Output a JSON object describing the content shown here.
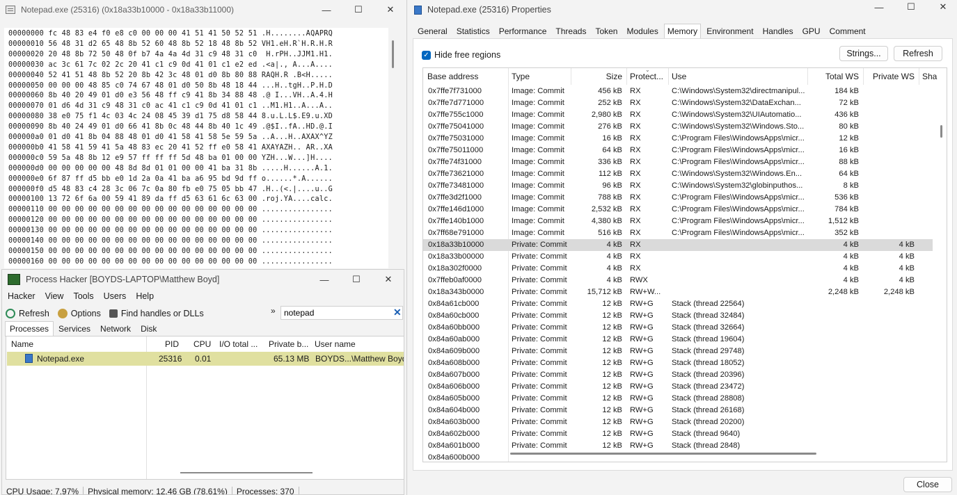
{
  "hex_window": {
    "title": "Notepad.exe (25316) (0x18a33b10000 - 0x18a33b11000)",
    "lines": [
      "00000000 fc 48 83 e4 f0 e8 c0 00 00 00 41 51 41 50 52 51 .H........AQAPRQ",
      "00000010 56 48 31 d2 65 48 8b 52 60 48 8b 52 18 48 8b 52 VH1.eH.R`H.R.H.R",
      "00000020 20 48 8b 72 50 48 0f b7 4a 4a 4d 31 c9 48 31 c0  H.rPH..JJM1.H1.",
      "00000030 ac 3c 61 7c 02 2c 20 41 c1 c9 0d 41 01 c1 e2 ed .<a|., A...A....",
      "00000040 52 41 51 48 8b 52 20 8b 42 3c 48 01 d0 8b 80 88 RAQH.R .B<H.....",
      "00000050 00 00 00 48 85 c0 74 67 48 01 d0 50 8b 48 18 44 ...H..tgH..P.H.D",
      "00000060 8b 40 20 49 01 d0 e3 56 48 ff c9 41 8b 34 88 48 .@ I...VH..A.4.H",
      "00000070 01 d6 4d 31 c9 48 31 c0 ac 41 c1 c9 0d 41 01 c1 ..M1.H1..A...A..",
      "00000080 38 e0 75 f1 4c 03 4c 24 08 45 39 d1 75 d8 58 44 8.u.L.L$.E9.u.XD",
      "00000090 8b 40 24 49 01 d0 66 41 8b 0c 48 44 8b 40 1c 49 .@$I..fA..HD.@.I",
      "000000a0 01 d0 41 8b 04 88 48 01 d0 41 58 41 58 5e 59 5a ..A...H..AXAX^YZ",
      "000000b0 41 58 41 59 41 5a 48 83 ec 20 41 52 ff e0 58 41 AXAYAZH.. AR..XA",
      "000000c0 59 5a 48 8b 12 e9 57 ff ff ff 5d 48 ba 01 00 00 YZH...W...]H....",
      "000000d0 00 00 00 00 00 48 8d 8d 01 01 00 00 41 ba 31 8b .....H......A.1.",
      "000000e0 6f 87 ff d5 bb e0 1d 2a 0a 41 ba a6 95 bd 9d ff o......*.A......",
      "000000f0 d5 48 83 c4 28 3c 06 7c 0a 80 fb e0 75 05 bb 47 .H..(<.|....u..G",
      "00000100 13 72 6f 6a 00 59 41 89 da ff d5 63 61 6c 63 00 .roj.YA....calc.",
      "00000110 00 00 00 00 00 00 00 00 00 00 00 00 00 00 00 00 ................",
      "00000120 00 00 00 00 00 00 00 00 00 00 00 00 00 00 00 00 ................",
      "00000130 00 00 00 00 00 00 00 00 00 00 00 00 00 00 00 00 ................",
      "00000140 00 00 00 00 00 00 00 00 00 00 00 00 00 00 00 00 ................",
      "00000150 00 00 00 00 00 00 00 00 00 00 00 00 00 00 00 00 ................",
      "00000160 00 00 00 00 00 00 00 00 00 00 00 00 00 00 00 00 ................"
    ]
  },
  "ph": {
    "title": "Process Hacker [BOYDS-LAPTOP\\Matthew Boyd]",
    "menu": [
      "Hacker",
      "View",
      "Tools",
      "Users",
      "Help"
    ],
    "toolbar": {
      "refresh": "Refresh",
      "options": "Options",
      "find": "Find handles or DLLs"
    },
    "search_value": "notepad",
    "tabs": [
      "Processes",
      "Services",
      "Network",
      "Disk"
    ],
    "columns": [
      "Name",
      "PID",
      "CPU",
      "I/O total ...",
      "Private b...",
      "User name"
    ],
    "row": {
      "name": "Notepad.exe",
      "pid": "25316",
      "cpu": "0.01",
      "private": "65.13 MB",
      "user": "BOYDS...\\Matthew Boyd"
    },
    "status": [
      "CPU Usage: 7.97%",
      "Physical memory: 12.46 GB (78.61%)",
      "Processes: 370"
    ]
  },
  "props": {
    "title": "Notepad.exe (25316) Properties",
    "tabs": [
      "General",
      "Statistics",
      "Performance",
      "Threads",
      "Token",
      "Modules",
      "Memory",
      "Environment",
      "Handles",
      "GPU",
      "Comment"
    ],
    "hide_free": "Hide free regions",
    "strings_btn": "Strings...",
    "refresh_btn": "Refresh",
    "close_btn": "Close",
    "columns": [
      "Base address",
      "Type",
      "Size",
      "Protect...",
      "Use",
      "Total WS",
      "Private WS",
      "Sha"
    ],
    "rows": [
      [
        "0x7ffe7f731000",
        "Image: Commit",
        "456 kB",
        "RX",
        "C:\\Windows\\System32\\directmanipul...",
        "184 kB",
        ""
      ],
      [
        "0x7ffe7d771000",
        "Image: Commit",
        "252 kB",
        "RX",
        "C:\\Windows\\System32\\DataExchan...",
        "72 kB",
        ""
      ],
      [
        "0x7ffe755c1000",
        "Image: Commit",
        "2,980 kB",
        "RX",
        "C:\\Windows\\System32\\UIAutomatio...",
        "436 kB",
        ""
      ],
      [
        "0x7ffe75041000",
        "Image: Commit",
        "276 kB",
        "RX",
        "C:\\Windows\\System32\\Windows.Sto...",
        "80 kB",
        ""
      ],
      [
        "0x7ffe75031000",
        "Image: Commit",
        "16 kB",
        "RX",
        "C:\\Program Files\\WindowsApps\\micr...",
        "12 kB",
        ""
      ],
      [
        "0x7ffe75011000",
        "Image: Commit",
        "64 kB",
        "RX",
        "C:\\Program Files\\WindowsApps\\micr...",
        "16 kB",
        ""
      ],
      [
        "0x7ffe74f31000",
        "Image: Commit",
        "336 kB",
        "RX",
        "C:\\Program Files\\WindowsApps\\micr...",
        "88 kB",
        ""
      ],
      [
        "0x7ffe73621000",
        "Image: Commit",
        "112 kB",
        "RX",
        "C:\\Windows\\System32\\Windows.En...",
        "64 kB",
        ""
      ],
      [
        "0x7ffe73481000",
        "Image: Commit",
        "96 kB",
        "RX",
        "C:\\Windows\\System32\\globinputhos...",
        "8 kB",
        ""
      ],
      [
        "0x7ffe3d2f1000",
        "Image: Commit",
        "788 kB",
        "RX",
        "C:\\Program Files\\WindowsApps\\micr...",
        "536 kB",
        ""
      ],
      [
        "0x7ffe146d1000",
        "Image: Commit",
        "2,532 kB",
        "RX",
        "C:\\Program Files\\WindowsApps\\micr...",
        "784 kB",
        ""
      ],
      [
        "0x7ffe140b1000",
        "Image: Commit",
        "4,380 kB",
        "RX",
        "C:\\Program Files\\WindowsApps\\micr...",
        "1,512 kB",
        ""
      ],
      [
        "0x7ff68e791000",
        "Image: Commit",
        "516 kB",
        "RX",
        "C:\\Program Files\\WindowsApps\\micr...",
        "352 kB",
        ""
      ],
      [
        "0x18a33b10000",
        "Private: Commit",
        "4 kB",
        "RX",
        "",
        "4 kB",
        "4 kB"
      ],
      [
        "0x18a33b00000",
        "Private: Commit",
        "4 kB",
        "RX",
        "",
        "4 kB",
        "4 kB"
      ],
      [
        "0x18a302f0000",
        "Private: Commit",
        "4 kB",
        "RX",
        "",
        "4 kB",
        "4 kB"
      ],
      [
        "0x7ffeb0af0000",
        "Private: Commit",
        "4 kB",
        "RWX",
        "",
        "4 kB",
        "4 kB"
      ],
      [
        "0x18a343b0000",
        "Private: Commit",
        "15,712 kB",
        "RW+W...",
        "",
        "2,248 kB",
        "2,248 kB"
      ],
      [
        "0x84a61cb000",
        "Private: Commit",
        "12 kB",
        "RW+G",
        "Stack (thread 22564)",
        "",
        ""
      ],
      [
        "0x84a60cb000",
        "Private: Commit",
        "12 kB",
        "RW+G",
        "Stack (thread 32484)",
        "",
        ""
      ],
      [
        "0x84a60bb000",
        "Private: Commit",
        "12 kB",
        "RW+G",
        "Stack (thread 32664)",
        "",
        ""
      ],
      [
        "0x84a60ab000",
        "Private: Commit",
        "12 kB",
        "RW+G",
        "Stack (thread 19604)",
        "",
        ""
      ],
      [
        "0x84a609b000",
        "Private: Commit",
        "12 kB",
        "RW+G",
        "Stack (thread 29748)",
        "",
        ""
      ],
      [
        "0x84a608b000",
        "Private: Commit",
        "12 kB",
        "RW+G",
        "Stack (thread 18052)",
        "",
        ""
      ],
      [
        "0x84a607b000",
        "Private: Commit",
        "12 kB",
        "RW+G",
        "Stack (thread 20396)",
        "",
        ""
      ],
      [
        "0x84a606b000",
        "Private: Commit",
        "12 kB",
        "RW+G",
        "Stack (thread 23472)",
        "",
        ""
      ],
      [
        "0x84a605b000",
        "Private: Commit",
        "12 kB",
        "RW+G",
        "Stack (thread 28808)",
        "",
        ""
      ],
      [
        "0x84a604b000",
        "Private: Commit",
        "12 kB",
        "RW+G",
        "Stack (thread 26168)",
        "",
        ""
      ],
      [
        "0x84a603b000",
        "Private: Commit",
        "12 kB",
        "RW+G",
        "Stack (thread 20200)",
        "",
        ""
      ],
      [
        "0x84a602b000",
        "Private: Commit",
        "12 kB",
        "RW+G",
        "Stack (thread 9640)",
        "",
        ""
      ],
      [
        "0x84a601b000",
        "Private: Commit",
        "12 kB",
        "RW+G",
        "Stack (thread 2848)",
        "",
        ""
      ],
      [
        "0x84a600b000",
        "",
        "",
        "",
        "",
        "",
        ""
      ]
    ],
    "selected_row": 13
  },
  "window_controls": {
    "minimize": "—",
    "maximize": "☐",
    "close": "✕"
  }
}
